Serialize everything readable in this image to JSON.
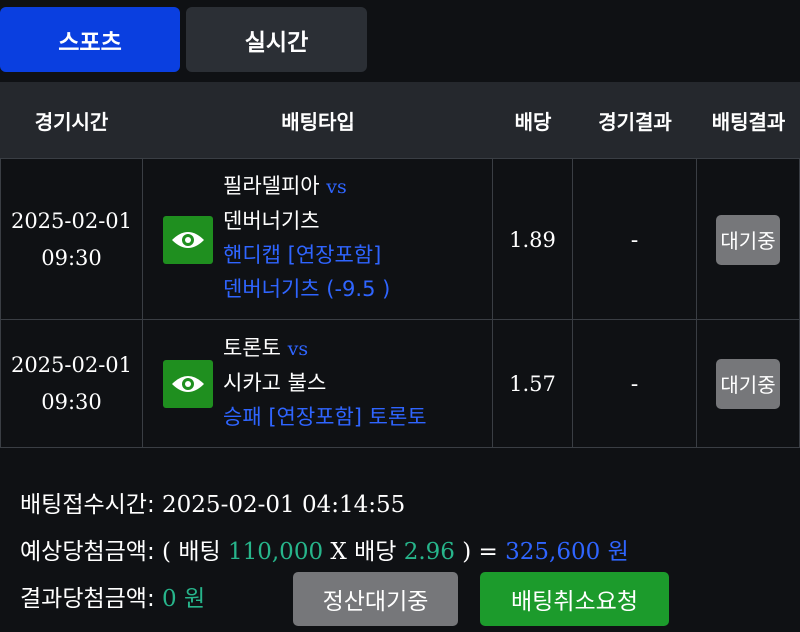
{
  "tabs": [
    {
      "label": "스포츠",
      "active": true
    },
    {
      "label": "실시간",
      "active": false
    }
  ],
  "table": {
    "headers": {
      "time": "경기시간",
      "type": "배팅타입",
      "odds": "배당",
      "game_result": "경기결과",
      "bet_result": "배팅결과"
    },
    "rows": [
      {
        "date": "2025-02-01",
        "time": "09:30",
        "home": "필라델피아",
        "vs": "vs",
        "away": "덴버너기츠",
        "market": "핸디캡 [연장포함]",
        "pick": "덴버너기츠 (-9.5 )",
        "odds": "1.89",
        "game_result": "-",
        "status": "대기중"
      },
      {
        "date": "2025-02-01",
        "time": "09:30",
        "home": "토론토",
        "vs": "vs",
        "away": "시카고 불스",
        "market": "승패 [연장포함] 토론토",
        "odds": "1.57",
        "game_result": "-",
        "status": "대기중"
      }
    ]
  },
  "summary": {
    "received_label": "배팅접수시간:",
    "received_time": "2025-02-01 04:14:55",
    "expected_label": "예상당첨금액:",
    "paren_open": "(",
    "bet_label": "배팅",
    "bet_amount": "110,000",
    "times": "X",
    "odds_label": "배당",
    "total_odds": "2.96",
    "paren_close": ") =",
    "expected_amount": "325,600 원",
    "result_label": "결과당첨금액:",
    "result_amount": "0 원",
    "settle_button": "정산대기중",
    "cancel_button": "배팅취소요청"
  },
  "colors": {
    "accent_blue": "#0a3fe0",
    "link_blue": "#2f65ff",
    "amount_green": "#27b58b",
    "button_green": "#1c9b2c",
    "button_gray": "#76777a"
  },
  "icons": [
    "eye-icon"
  ]
}
